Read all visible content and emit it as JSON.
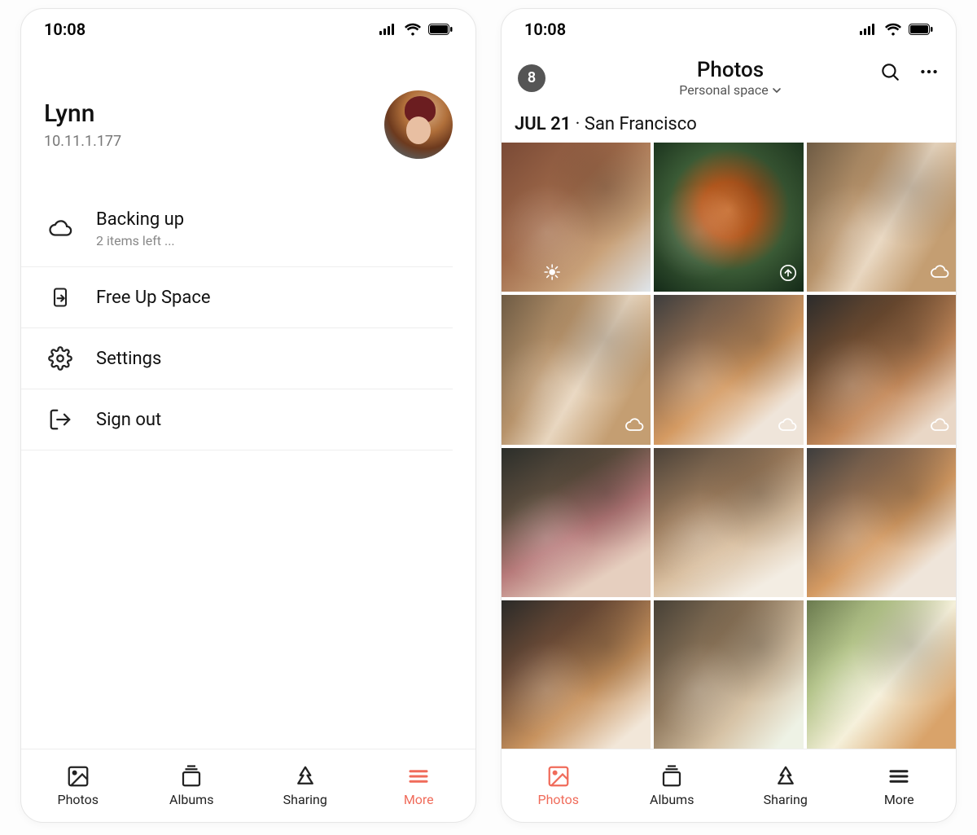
{
  "status": {
    "time": "10:08"
  },
  "left": {
    "profile": {
      "name": "Lynn",
      "ip": "10.11.1.177"
    },
    "menu": [
      {
        "icon": "cloud",
        "title": "Backing up",
        "subtitle": "2 items left ..."
      },
      {
        "icon": "freeup",
        "title": "Free Up Space"
      },
      {
        "icon": "settings",
        "title": "Settings"
      },
      {
        "icon": "signout",
        "title": "Sign out"
      }
    ],
    "tabs": [
      {
        "id": "photos",
        "label": "Photos",
        "active": false
      },
      {
        "id": "albums",
        "label": "Albums",
        "active": false
      },
      {
        "id": "sharing",
        "label": "Sharing",
        "active": false
      },
      {
        "id": "more",
        "label": "More",
        "active": true
      }
    ]
  },
  "right": {
    "badge_count": "8",
    "title": "Photos",
    "space": "Personal space",
    "section": {
      "date": "JUL 21",
      "location": "San Francisco"
    },
    "thumbs": [
      {
        "overlay": "sync-dots",
        "overlayPos": "center"
      },
      {
        "overlay": "upload"
      },
      {
        "overlay": "cloud"
      },
      {
        "overlay": "cloud"
      },
      {
        "overlay": "cloud"
      },
      {
        "overlay": "cloud"
      },
      {},
      {},
      {},
      {},
      {},
      {}
    ],
    "tabs": [
      {
        "id": "photos",
        "label": "Photos",
        "active": true
      },
      {
        "id": "albums",
        "label": "Albums",
        "active": false
      },
      {
        "id": "sharing",
        "label": "Sharing",
        "active": false
      },
      {
        "id": "more",
        "label": "More",
        "active": false
      }
    ]
  }
}
